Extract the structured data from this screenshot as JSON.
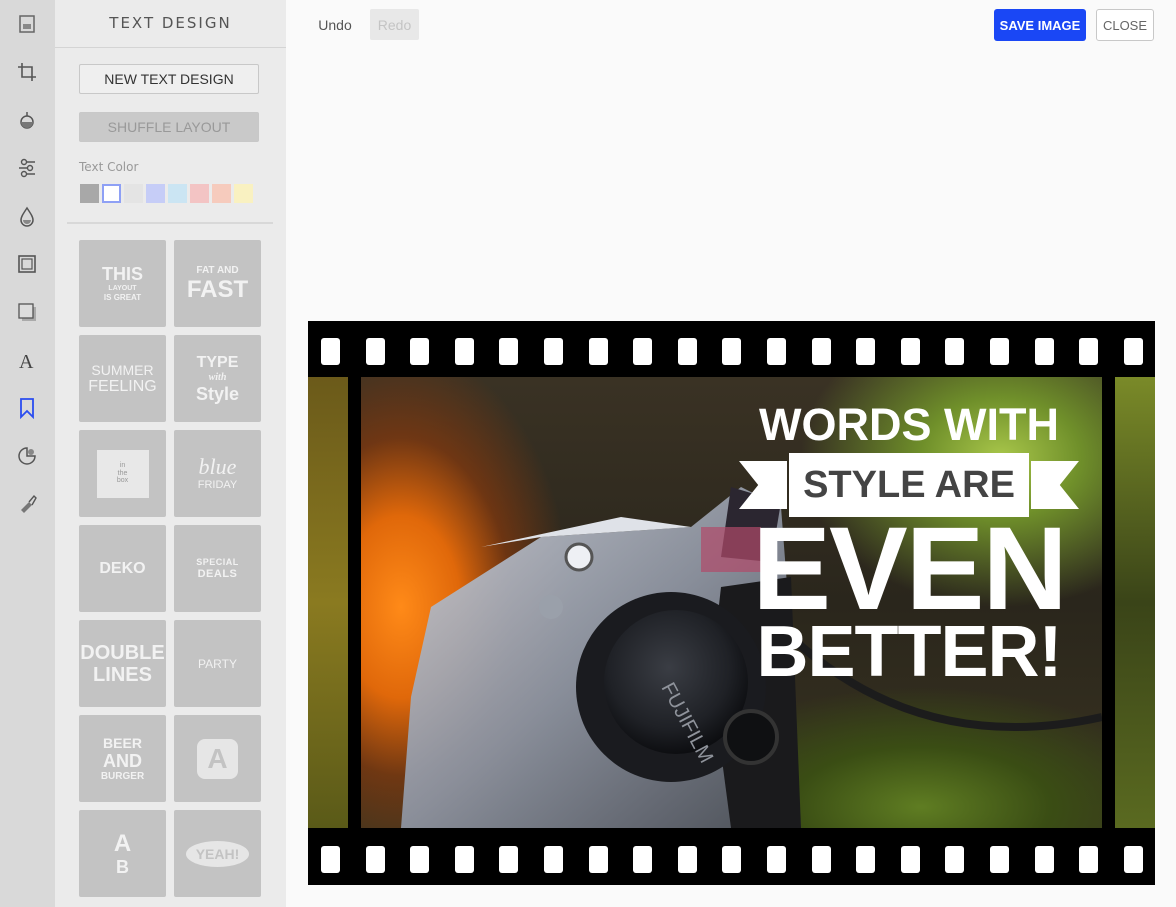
{
  "panel": {
    "title": "TEXT DESIGN",
    "new_label": "NEW TEXT DESIGN",
    "shuffle_label": "SHUFFLE LAYOUT",
    "text_color_label": "Text Color",
    "swatches": [
      "#a8a8a8",
      "#ffffff",
      "#e4e4e4",
      "#c6cdf7",
      "#cbe5f3",
      "#f3c4c4",
      "#f6cbbd",
      "#f9f1c1"
    ]
  },
  "tools": [
    "image-icon",
    "crop-icon",
    "filter-icon",
    "adjust-icon",
    "drop-icon",
    "frame-icon",
    "shadow-icon",
    "text-icon",
    "bookmark-icon",
    "sticker-icon",
    "brush-icon"
  ],
  "designs": [
    {
      "l1": "THIS",
      "l2": "LAYOUT",
      "l3": "IS GREAT"
    },
    {
      "l1": "FAT AND",
      "l2": "FAST",
      "l3": ""
    },
    {
      "l1": "SUMMER",
      "l2": "FEELING",
      "l3": ""
    },
    {
      "l1": "TYPE",
      "l2": "with",
      "l3": "Style"
    },
    {
      "l1": "in",
      "l2": "the",
      "l3": "box"
    },
    {
      "l1": "blue",
      "l2": "FRIDAY",
      "l3": ""
    },
    {
      "l1": "DEKO",
      "l2": "",
      "l3": ""
    },
    {
      "l1": "SPECIAL",
      "l2": "DEALS",
      "l3": ""
    },
    {
      "l1": "DOUBLE",
      "l2": "LINES",
      "l3": ""
    },
    {
      "l1": "",
      "l2": "PARTY",
      "l3": ""
    },
    {
      "l1": "BEER",
      "l2": "AND",
      "l3": "BURGER"
    },
    {
      "l1": "A",
      "l2": "",
      "l3": ""
    },
    {
      "l1": "A",
      "l2": "B",
      "l3": ""
    },
    {
      "l1": "YEAH!",
      "l2": "",
      "l3": ""
    }
  ],
  "topbar": {
    "undo": "Undo",
    "redo": "Redo",
    "save": "SAVE IMAGE",
    "close": "CLOSE"
  },
  "canvas": {
    "line1": "WORDS WITH",
    "line2": "STYLE ARE",
    "line3": "EVEN",
    "line4": "BETTER!",
    "camera_brand": "FUJIFILM"
  }
}
